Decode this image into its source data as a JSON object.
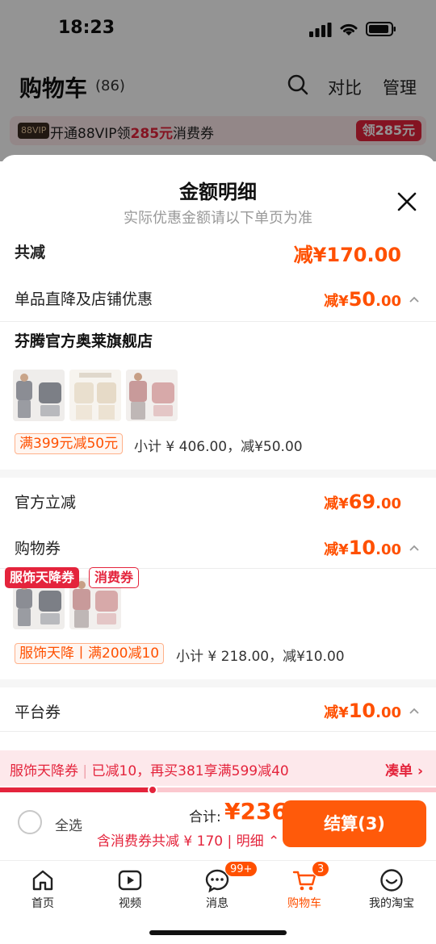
{
  "status_bar": {
    "time": "18:23"
  },
  "header": {
    "title": "购物车",
    "count": "(86)",
    "compare": "对比",
    "manage": "管理"
  },
  "vip_banner": {
    "badge": "88VIP",
    "text_before": "开通88VIP领",
    "highlight": "285元",
    "text_after": "消费券",
    "button": "领285元"
  },
  "sheet": {
    "title": "金额明细",
    "subtitle": "实际优惠金额请以下单页为准",
    "total_reduce": {
      "label": "共减",
      "prefix": "减¥",
      "int": "170",
      "dec": ".00"
    },
    "store_discount": {
      "label": "单品直降及店铺优惠",
      "prefix": "减¥",
      "int": "50",
      "dec": ".00"
    },
    "shop": {
      "name": "芬腾官方奥莱旗舰店",
      "promo": "满399元减50元",
      "subtotal": "小计 ¥ 406.00，减¥50.00"
    },
    "official_reduce": {
      "label": "官方立减",
      "prefix": "减¥",
      "int": "69",
      "dec": ".00"
    },
    "shopping_coupon": {
      "label": "购物券",
      "prefix": "减¥",
      "int": "10",
      "dec": ".00",
      "promo": "服饰天降丨满200减10",
      "subtotal": "小计 ¥ 218.00，减¥10.00"
    },
    "platform_coupon": {
      "label": "平台券",
      "prefix": "减¥",
      "int": "10",
      "dec": ".00"
    }
  },
  "coupon_tags": {
    "tag_a": "服饰天降券",
    "tag_b": "消费券"
  },
  "coupon_bar": {
    "name": "服饰天降券",
    "message": "已减10，再买381享满599减40",
    "link": "凑单",
    "progress": 0.35
  },
  "checkout": {
    "select_all": "全选",
    "total_label": "合计:",
    "total_value": "¥236",
    "discount_text": "含消费券共减 ¥ 170",
    "detail_link": "明细",
    "button": "结算(3)"
  },
  "tabbar": {
    "items": [
      {
        "label": "首页",
        "icon": "home-icon"
      },
      {
        "label": "视频",
        "icon": "video-icon"
      },
      {
        "label": "消息",
        "icon": "message-icon",
        "badge": "99+"
      },
      {
        "label": "购物车",
        "icon": "cart-icon",
        "badge": "3",
        "active": true
      },
      {
        "label": "我的淘宝",
        "icon": "profile-icon"
      }
    ]
  },
  "colors": {
    "accent": "#ff5000",
    "coupon_red": "#e4243c"
  }
}
